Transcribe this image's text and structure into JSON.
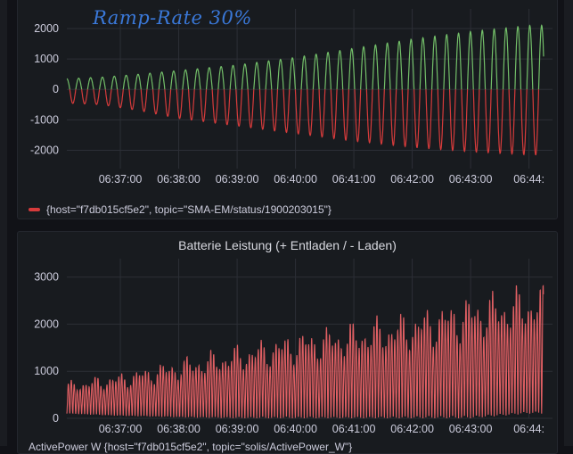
{
  "annotation": "Ramp-Rate 30%",
  "chart_data": [
    {
      "type": "line",
      "title": "",
      "ylim": [
        -2600,
        2350
      ],
      "y_ticks": [
        2000,
        1000,
        0,
        -1000,
        -2000
      ],
      "x_ticks": [
        "06:37:00",
        "06:38:00",
        "06:39:00",
        "06:40:00",
        "06:41:00",
        "06:42:00",
        "06:43:00",
        "06:44:"
      ],
      "x_range": [
        "06:36:05",
        "06:44:15"
      ],
      "series": [
        {
          "name": "{host=\"f7db015cf5e2\", topic=\"SMA-EM/status/1900203015\"}",
          "oscillation_period_s": 12.2,
          "envelope": [
            {
              "x": "06:36:05",
              "pos": 350,
              "neg": -450
            },
            {
              "x": "06:36:40",
              "pos": 400,
              "neg": -500
            },
            {
              "x": "06:37:20",
              "pos": 500,
              "neg": -700
            },
            {
              "x": "06:38:00",
              "pos": 620,
              "neg": -950
            },
            {
              "x": "06:39:00",
              "pos": 800,
              "neg": -1200
            },
            {
              "x": "06:40:00",
              "pos": 1050,
              "neg": -1450
            },
            {
              "x": "06:41:00",
              "pos": 1350,
              "neg": -1700
            },
            {
              "x": "06:42:00",
              "pos": 1650,
              "neg": -1900
            },
            {
              "x": "06:43:00",
              "pos": 1900,
              "neg": -2050
            },
            {
              "x": "06:44:00",
              "pos": 2100,
              "neg": -2150
            }
          ],
          "positive_color": "#73bf69",
          "negative_color": "#d63b3b"
        }
      ]
    },
    {
      "type": "line",
      "title": "Batterie Leistung (+ Entladen / - Laden)",
      "ylim": [
        0,
        3200
      ],
      "y_ticks": [
        3000,
        2000,
        1000,
        0
      ],
      "x_ticks": [
        "06:37:00",
        "06:38:00",
        "06:39:00",
        "06:40:00",
        "06:41:00",
        "06:42:00",
        "06:43:00",
        "06:44:"
      ],
      "x_range": [
        "06:36:05",
        "06:44:15"
      ],
      "series": [
        {
          "name": "ActivePower W {host=\"f7db015cf5e2\", topic=\"solis/ActivePower_W\"}",
          "oscillation_period_s": 6.1,
          "envelope": [
            {
              "x": "06:36:05",
              "min": 100,
              "max": 800
            },
            {
              "x": "06:37:00",
              "min": 50,
              "max": 1000
            },
            {
              "x": "06:38:00",
              "min": 20,
              "max": 1300
            },
            {
              "x": "06:39:00",
              "min": 0,
              "max": 1600
            },
            {
              "x": "06:40:00",
              "min": 0,
              "max": 1900
            },
            {
              "x": "06:41:00",
              "min": 0,
              "max": 2100
            },
            {
              "x": "06:42:00",
              "min": 0,
              "max": 2350
            },
            {
              "x": "06:43:00",
              "min": 0,
              "max": 2700
            },
            {
              "x": "06:44:00",
              "min": 100,
              "max": 2900
            }
          ],
          "color": "#e05f63"
        }
      ]
    }
  ]
}
